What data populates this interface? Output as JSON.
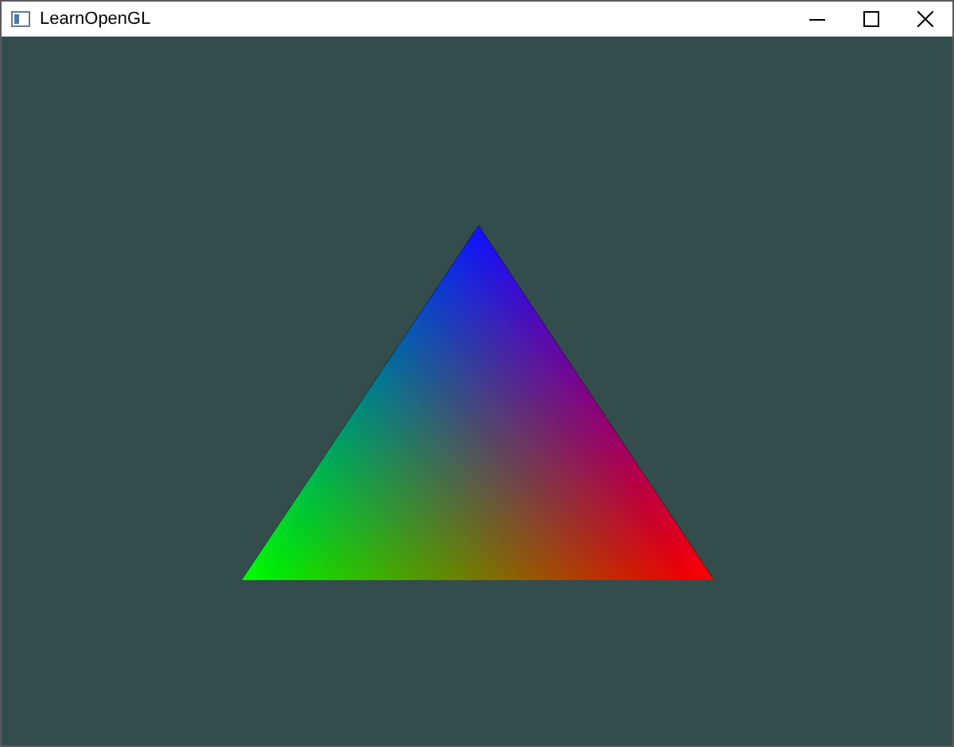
{
  "window": {
    "title": "LearnOpenGL"
  }
}
